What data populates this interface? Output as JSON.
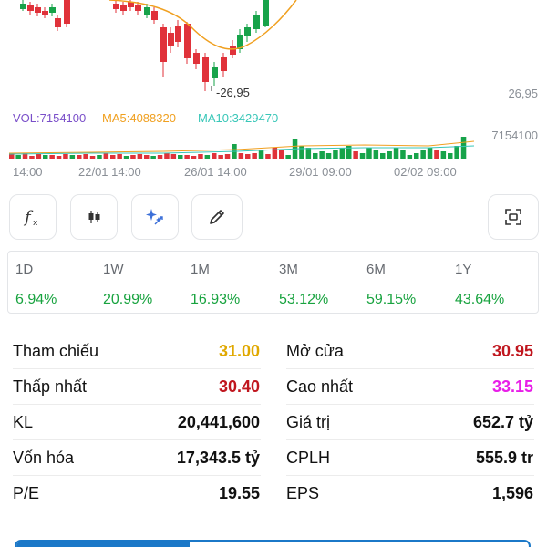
{
  "chart": {
    "low_label": "-26,95",
    "axis_price": "26,95",
    "vol_label": "VOL:7154100",
    "ma5_label": "MA5:4088320",
    "ma10_label": "MA10:3429470",
    "axis_volume": "7154100",
    "time_labels": [
      "14:00",
      "22/01 14:00",
      "26/01 14:00",
      "29/01 09:00",
      "02/02 09:00"
    ],
    "colors": {
      "up": "#17a34a",
      "down": "#e0323a",
      "ma5": "#f0a020",
      "ma10": "#39c7b8",
      "vol": "#7a4fc9"
    }
  },
  "toolbar": {
    "buttons": [
      {
        "icon": "function-icon"
      },
      {
        "icon": "candlestick-icon"
      },
      {
        "icon": "ai-sparkle-icon"
      },
      {
        "icon": "pencil-icon"
      },
      {
        "icon": "fullscreen-icon"
      }
    ]
  },
  "performance": [
    {
      "label": "1D",
      "value": "6.94%"
    },
    {
      "label": "1W",
      "value": "20.99%"
    },
    {
      "label": "1M",
      "value": "16.93%"
    },
    {
      "label": "3M",
      "value": "53.12%"
    },
    {
      "label": "6M",
      "value": "59.15%"
    },
    {
      "label": "1Y",
      "value": "43.64%"
    }
  ],
  "stats": {
    "left": [
      {
        "label": "Tham chiếu",
        "value": "31.00",
        "color": "#e0a800"
      },
      {
        "label": "Thấp nhất",
        "value": "30.40",
        "color": "#c0161e"
      },
      {
        "label": "KL",
        "value": "20,441,600",
        "color": "#111111"
      },
      {
        "label": "Vốn hóa",
        "value": "17,343.5 tỷ",
        "color": "#111111"
      },
      {
        "label": "P/E",
        "value": "19.55",
        "color": "#111111"
      }
    ],
    "right": [
      {
        "label": "Mở cửa",
        "value": "30.95",
        "color": "#c0161e"
      },
      {
        "label": "Cao nhất",
        "value": "33.15",
        "color": "#e81ee8"
      },
      {
        "label": "Giá trị",
        "value": "652.7 tỷ",
        "color": "#111111"
      },
      {
        "label": "CPLH",
        "value": "555.9 tr",
        "color": "#111111"
      },
      {
        "label": "EPS",
        "value": "1,596",
        "color": "#111111"
      }
    ]
  }
}
